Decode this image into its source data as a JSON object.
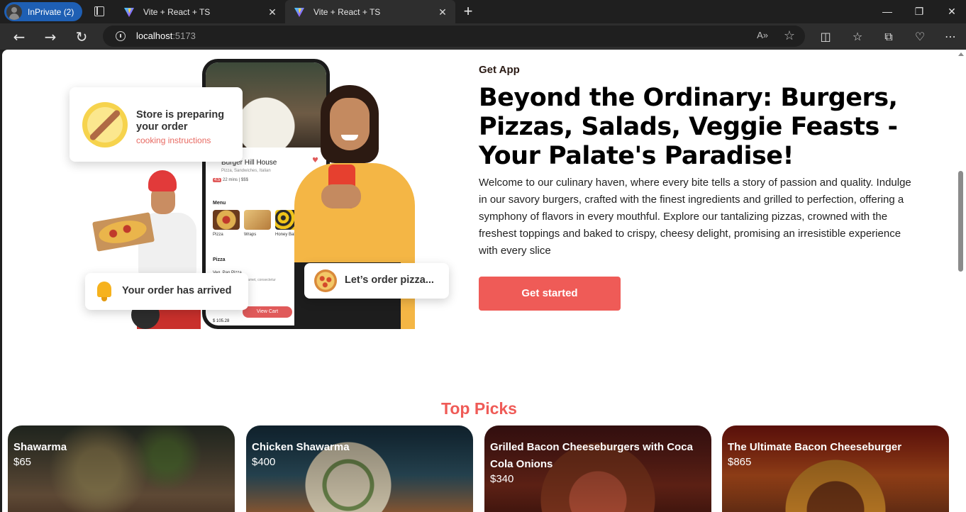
{
  "browser": {
    "profile_label": "InPrivate (2)",
    "tabs": [
      {
        "title": "Vite + React + TS",
        "active": false
      },
      {
        "title": "Vite + React + TS",
        "active": true
      }
    ],
    "url_host": "localhost",
    "url_port": ":5173",
    "read_aloud_icon": "A»"
  },
  "hero": {
    "eyebrow": "Get App",
    "headline": "Beyond the Ordinary: Burgers, Pizzas, Salads, Veggie Feasts - Your Palate's Paradise!",
    "body": "Welcome to our culinary haven, where every bite tells a story of passion and quality. Indulge in our savory burgers, crafted with the finest ingredients and grilled to perfection, offering a symphony of flavors in every mouthful. Explore our tantalizing pizzas, crowned with the freshest toppings and baked to crispy, cheesy delight, promising an irresistible experience with every slice",
    "cta_label": "Get started",
    "accent_color": "#ef5b57"
  },
  "illustration": {
    "card_preparing_title": "Store is preparing your order",
    "card_preparing_sub": "cooking instructions",
    "card_arrived": "Your order has arrived",
    "card_order": "Let’s order pizza...",
    "phone": {
      "restaurant": "Burger Hill House",
      "cuisine": "Pizza, Sandwiches, Italian",
      "rating": "4.5",
      "meta": "22 mins | $$$",
      "menu_label": "Menu",
      "menu_items": [
        "Pizza",
        "Wraps",
        "Honey Baked C..."
      ],
      "section": "Pizza",
      "item": "Veg. Pan Pizza",
      "item_desc": "Lorem ipsum dolor sit amet, consectetur adipiscing elit.",
      "cart_label": "View Cart",
      "price": "$ 105.28"
    }
  },
  "top_picks": {
    "title": "Top Picks",
    "items": [
      {
        "name": "Shawarma",
        "price": "$65"
      },
      {
        "name": "Chicken Shawarma",
        "price": "$400"
      },
      {
        "name": "Grilled Bacon Cheeseburgers with Coca Cola Onions",
        "price": "$340"
      },
      {
        "name": "The Ultimate Bacon Cheeseburger",
        "price": "$865"
      }
    ]
  }
}
